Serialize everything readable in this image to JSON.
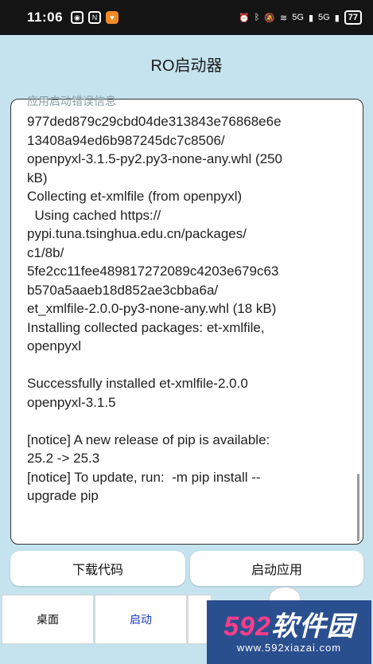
{
  "status_bar": {
    "time": "11:06",
    "battery": "77",
    "net1": "5G",
    "net2": "5G"
  },
  "app": {
    "title": "RO启动器"
  },
  "log": {
    "label": "应用启动错误信息",
    "lines": [
      "977ded879c29cbd04de313843e76868e6e",
      "13408a94ed6b987245dc7c8506/",
      "openpyxl-3.1.5-py2.py3-none-any.whl (250",
      "kB)",
      "Collecting et-xmlfile (from openpyxl)",
      "  Using cached https://",
      "pypi.tuna.tsinghua.edu.cn/packages/",
      "c1/8b/",
      "5fe2cc11fee489817272089c4203e679c63",
      "b570a5aaeb18d852ae3cbba6a/",
      "et_xmlfile-2.0.0-py3-none-any.whl (18 kB)",
      "Installing collected packages: et-xmlfile,",
      "openpyxl",
      "",
      "Successfully installed et-xmlfile-2.0.0",
      "openpyxl-3.1.5",
      "",
      "[notice] A new release of pip is available:",
      "25.2 -> 25.3",
      "[notice] To update, run:  -m pip install --",
      "upgrade pip"
    ]
  },
  "buttons": {
    "download_code": "下载代码",
    "launch_app": "启动应用"
  },
  "tabs": {
    "desktop": "桌面",
    "launch": "启动"
  },
  "watermark": {
    "brand_num": "592",
    "brand_text": "软件园",
    "url": "www.592xiazai.com"
  },
  "colors": {
    "background": "#c5e3ee",
    "active_tab": "#1a3bc2"
  }
}
